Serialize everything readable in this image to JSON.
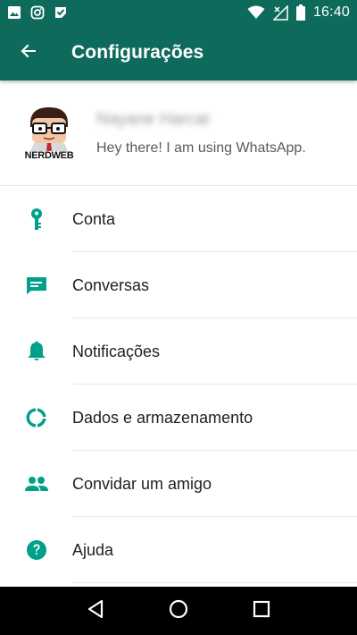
{
  "status_bar": {
    "time": "16:40",
    "left_icons": [
      "image-icon",
      "instagram-icon",
      "check-flag-icon"
    ],
    "right_icons": [
      "wifi-icon",
      "cell-signal-icon",
      "battery-icon"
    ]
  },
  "app_bar": {
    "back_icon": "arrow-left-icon",
    "title": "Configurações"
  },
  "profile": {
    "name": "Nayane Harcar",
    "status": "Hey there! I am using WhatsApp.",
    "avatar_caption": "NERDWEB"
  },
  "menu": [
    {
      "id": "conta",
      "label": "Conta",
      "icon": "key-icon"
    },
    {
      "id": "conversas",
      "label": "Conversas",
      "icon": "chat-icon"
    },
    {
      "id": "notificacoes",
      "label": "Notificações",
      "icon": "bell-icon"
    },
    {
      "id": "dados",
      "label": "Dados e armazenamento",
      "icon": "data-usage-icon"
    },
    {
      "id": "convidar",
      "label": "Convidar um amigo",
      "icon": "people-icon"
    },
    {
      "id": "ajuda",
      "label": "Ajuda",
      "icon": "help-icon"
    }
  ],
  "nav_bar": {
    "buttons": [
      "back-triangle-icon",
      "home-circle-icon",
      "recents-square-icon"
    ]
  },
  "colors": {
    "primary": "#0e6b5c",
    "accent": "#00a08a",
    "nav": "#000000"
  }
}
